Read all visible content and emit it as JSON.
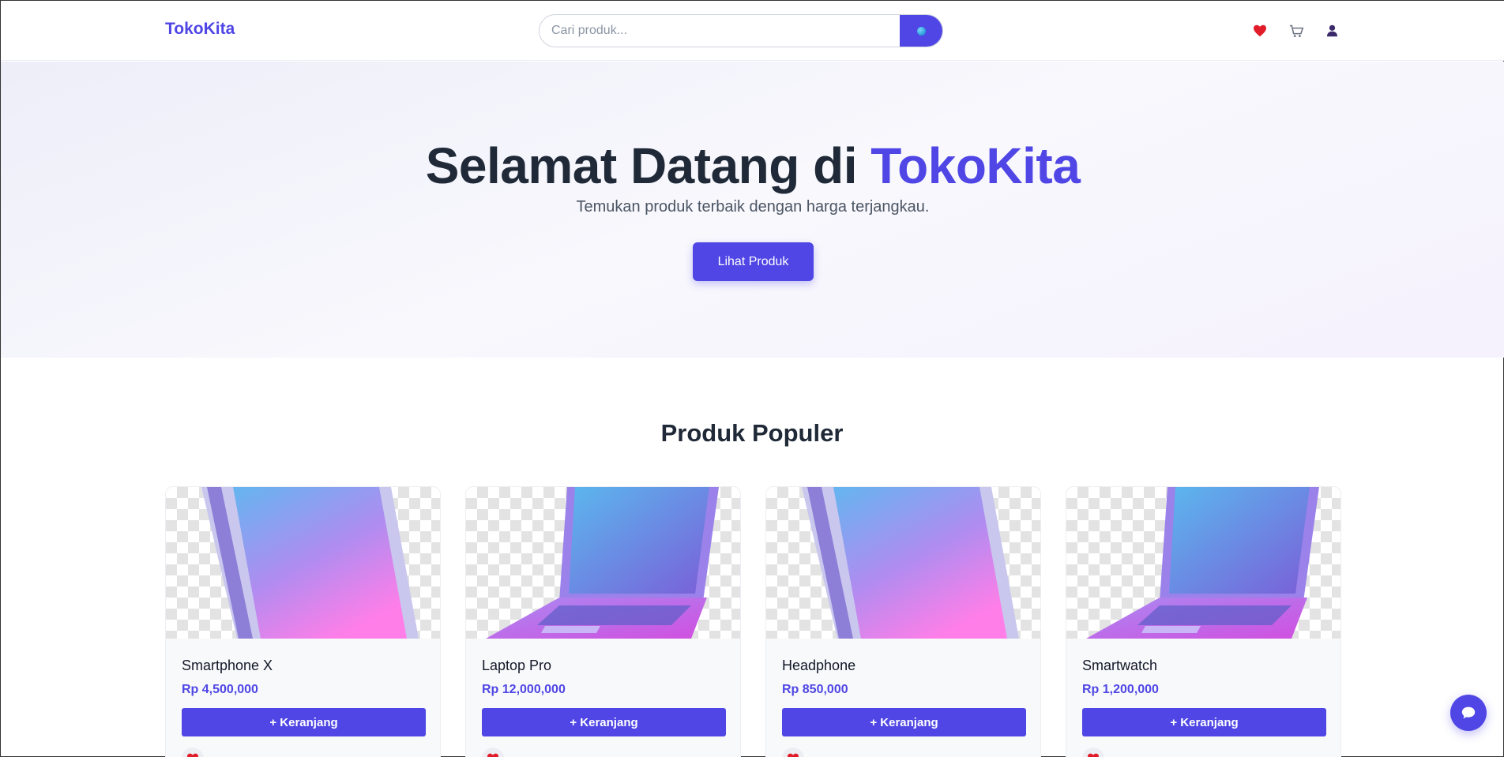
{
  "header": {
    "brand": "TokoKita",
    "search_placeholder": "Cari produk...",
    "search_button_icon": "search-icon",
    "icons": [
      "heart-icon",
      "cart-icon",
      "user-icon"
    ]
  },
  "hero": {
    "title_prefix": "Selamat Datang di ",
    "title_accent": "TokoKita",
    "subtitle": "Temukan produk terbaik dengan harga terjangkau.",
    "button_label": "Lihat Produk"
  },
  "products_section": {
    "title": "Produk Populer",
    "cart_button_label": "+ Keranjang",
    "items": [
      {
        "name": "Smartphone X",
        "price": "Rp 4,500,000",
        "image": "phone-image"
      },
      {
        "name": "Laptop Pro",
        "price": "Rp 12,000,000",
        "image": "laptop-image"
      },
      {
        "name": "Headphone",
        "price": "Rp 850,000",
        "image": "phone-image"
      },
      {
        "name": "Smartwatch",
        "price": "Rp 1,200,000",
        "image": "laptop-image"
      }
    ]
  },
  "chat": {
    "icon": "chat-bubble-icon"
  },
  "colors": {
    "accent": "#4f46e5",
    "heart": "#ef4444",
    "text": "#1f2937"
  }
}
